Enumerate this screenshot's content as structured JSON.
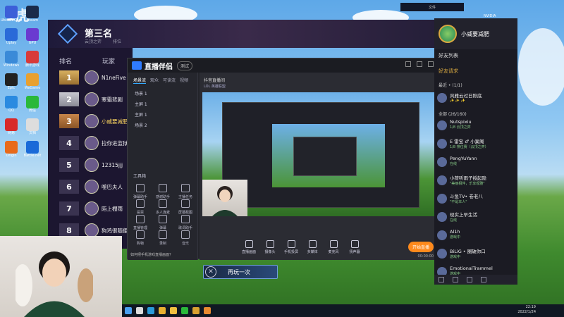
{
  "watermark": "1虎",
  "top_window_label": "文件",
  "corner_label": "NVIDIA",
  "desktop_icons": [
    {
      "name": "Ubisoft Connect",
      "color": "#3c5fd8"
    },
    {
      "name": "Steam",
      "color": "#1a2a4a"
    },
    {
      "name": "Uplay",
      "color": "#2a6ad8"
    },
    {
      "name": "GPU",
      "color": "#6a3ad0"
    },
    {
      "name": "Windows",
      "color": "#3a8ad8"
    },
    {
      "name": "腾讯游戏",
      "color": "#d83a3a"
    },
    {
      "name": "Epic",
      "color": "#222"
    },
    {
      "name": "WeGame",
      "color": "#e8a030"
    },
    {
      "name": "QQ",
      "color": "#2a8ae0"
    },
    {
      "name": "微信",
      "color": "#2ab83a"
    },
    {
      "name": "网易",
      "color": "#d82a2a"
    },
    {
      "name": "文档",
      "color": "#ddd"
    },
    {
      "name": "Origin",
      "color": "#e86a1a"
    },
    {
      "name": "Battle.net",
      "color": "#1a6ad8"
    }
  ],
  "game": {
    "title": "第三名",
    "subtitle": "云顶之弈",
    "mode": "排位",
    "header_rank": "排名",
    "header_player": "玩家",
    "leaderboard": [
      {
        "rank": "1",
        "name": "N1neFive"
      },
      {
        "rank": "2",
        "name": "寒霜悲剧"
      },
      {
        "rank": "3",
        "name": "小威要减肥"
      },
      {
        "rank": "4",
        "name": "拉你进监狱"
      },
      {
        "rank": "5",
        "name": "12315jjj"
      },
      {
        "rank": "6",
        "name": "噬巴夫人"
      },
      {
        "rank": "7",
        "name": "陌上棚雨"
      },
      {
        "rank": "8",
        "name": "狗鸡很随便"
      }
    ],
    "play_again": "再玩一次"
  },
  "streamer_app": {
    "name": "直播伴侣",
    "version": "测试",
    "tabs": [
      "场景流",
      "观众",
      "可读流",
      "视频"
    ],
    "scenes": [
      "场景 1",
      "主屏 1",
      "主屏 1",
      "场景 2"
    ],
    "stream_title": "抖音直播间",
    "stream_tags": "LOL 英雄联盟",
    "tools_label": "工具箱",
    "tools": [
      "弹幕助手",
      "感谢助手",
      "主播任务",
      "投票",
      "多人连麦",
      "屏幕截图",
      "直播管理",
      "弹幕",
      "歌词助手",
      "购物",
      "录制",
      "音乐"
    ],
    "bottom_tools": [
      "直播画面",
      "摄像头",
      "手机投屏",
      "多媒体",
      "麦克风",
      "扬声器"
    ],
    "start_button": "开始直播",
    "timer": "00:00:00",
    "warning": "如何把手机游戏直播画面？"
  },
  "friends": {
    "user": "小威要减肥",
    "list_label": "好友列表",
    "requests": "好友请求",
    "group1": "最近 • (1/1)",
    "group2": "全部 (26/160)",
    "items": [
      {
        "name": "风雅云过日照底",
        "status": "✨ ✨ ✨"
      },
      {
        "name": "Nutspixiu",
        "status": "1/8 云顶之弈"
      },
      {
        "name": "E 雷宝 ♂ 小案阁",
        "status": "1/8 排位赛（云顶之弈）"
      },
      {
        "name": "PengYuYann",
        "status": "在线"
      },
      {
        "name": "小荷听雨子授起隐",
        "status": "\"美丽相伴，乐享观雅\""
      },
      {
        "name": "斗鱼TV• 卷老八",
        "status": "\"不是本人\""
      },
      {
        "name": "现实上早生活",
        "status": "在线"
      },
      {
        "name": "Al1h",
        "status": "游戏中"
      },
      {
        "name": "BiLiG • 圈破你口",
        "status": "游戏中"
      },
      {
        "name": "EmotionalTrammel",
        "status": "游戏中"
      }
    ]
  },
  "taskbar": {
    "time": "22:19",
    "date": "2022/1/24"
  }
}
